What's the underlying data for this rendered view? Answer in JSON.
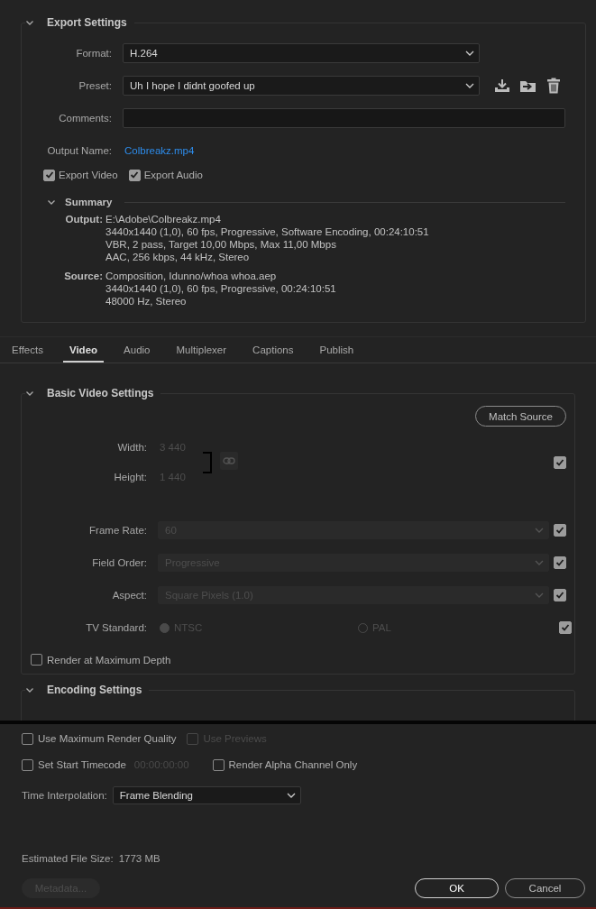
{
  "export_settings": {
    "title": "Export Settings",
    "expanded": true,
    "format": {
      "label": "Format:",
      "value": "H.264"
    },
    "preset": {
      "label": "Preset:",
      "value": "Uh I hope I didnt goofed up"
    },
    "comments": {
      "label": "Comments:"
    },
    "output_name": {
      "label": "Output Name:",
      "value": "Colbreakz.mp4"
    },
    "export_video": {
      "label": "Export Video",
      "checked": true
    },
    "export_audio": {
      "label": "Export Audio",
      "checked": true
    },
    "summary": {
      "title": "Summary",
      "expanded": true,
      "groups": [
        {
          "label": "Output:",
          "lines": [
            "E:\\Adobe\\Colbreakz.mp4",
            "3440x1440 (1,0), 60 fps, Progressive, Software Encoding, 00:24:10:51",
            "VBR, 2 pass, Target 10,00 Mbps, Max 11,00 Mbps",
            "AAC, 256 kbps, 44 kHz, Stereo"
          ]
        },
        {
          "label": "Source:",
          "lines": [
            "Composition, Idunno/whoa whoa.aep",
            "3440x1440 (1,0), 60 fps, Progressive, 00:24:10:51",
            "48000 Hz, Stereo"
          ]
        }
      ]
    }
  },
  "tabs": [
    {
      "label": "Effects",
      "selected": false
    },
    {
      "label": "Video",
      "selected": true
    },
    {
      "label": "Audio",
      "selected": false
    },
    {
      "label": "Multiplexer",
      "selected": false
    },
    {
      "label": "Captions",
      "selected": false
    },
    {
      "label": "Publish",
      "selected": false
    }
  ],
  "basic_video": {
    "title": "Basic Video Settings",
    "expanded": true,
    "match_source": "Match Source",
    "width": {
      "label": "Width:",
      "value": "3 440"
    },
    "height": {
      "label": "Height:",
      "value": "1 440"
    },
    "size_match": {
      "checked": true
    },
    "rows": [
      {
        "label": "Frame Rate:",
        "value": "60",
        "checked": true
      },
      {
        "label": "Field Order:",
        "value": "Progressive",
        "checked": true
      },
      {
        "label": "Aspect:",
        "value": "Square Pixels (1.0)",
        "checked": true
      }
    ],
    "tv_standard": {
      "label": "TV Standard:",
      "checked": true,
      "options": [
        {
          "label": "NTSC",
          "selected": true
        },
        {
          "label": "PAL",
          "selected": false
        }
      ]
    },
    "max_depth": {
      "label": "Render at Maximum Depth",
      "checked": false
    }
  },
  "encoding": {
    "title": "Encoding Settings",
    "expanded": true
  },
  "bottom": {
    "max_quality": {
      "label": "Use Maximum Render Quality",
      "checked": false,
      "disabled": false
    },
    "use_previews": {
      "label": "Use Previews",
      "checked": false,
      "disabled": true
    },
    "start_timecode": {
      "label": "Set Start Timecode",
      "checked": false,
      "disabled": false,
      "value": "00:00:00:00"
    },
    "alpha_only": {
      "label": "Render Alpha Channel Only",
      "checked": false,
      "disabled": false
    },
    "time_interpolation": {
      "label": "Time Interpolation:",
      "value": "Frame Blending"
    },
    "file_size": {
      "label": "Estimated File Size:",
      "value": "1773 MB"
    },
    "buttons": [
      {
        "label": "Metadata...",
        "kind": "side",
        "disabled": true
      },
      {
        "label": "OK",
        "kind": "primary",
        "disabled": false
      },
      {
        "label": "Cancel",
        "kind": "secondary",
        "disabled": false
      }
    ]
  }
}
